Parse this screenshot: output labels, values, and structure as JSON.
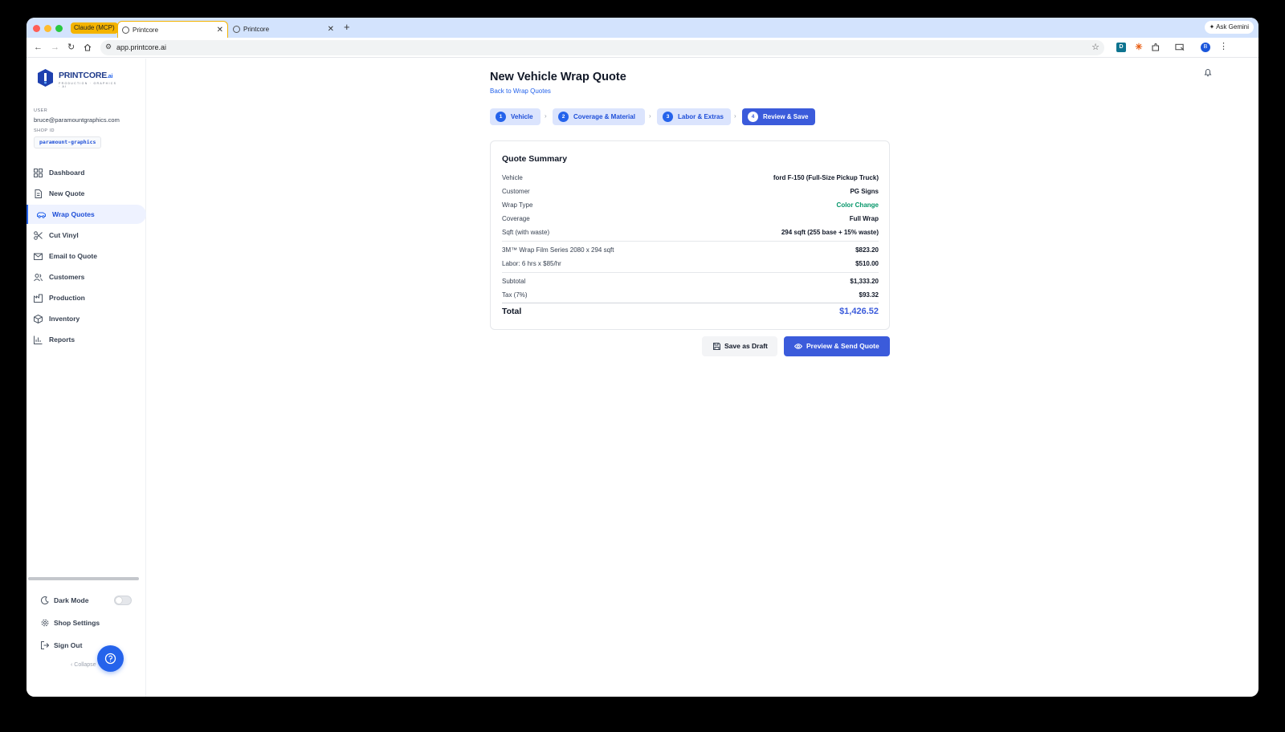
{
  "browser": {
    "tab_group_label": "Claude (MCP)",
    "tabs": [
      {
        "title": "Printcore",
        "active": true
      },
      {
        "title": "Printcore",
        "active": false
      }
    ],
    "url": "app.printcore.ai",
    "ask_gemini": "Ask Gemini",
    "profile_initial": "B"
  },
  "sidebar": {
    "logo_text": "PRINTCORE",
    "logo_ai": ".ai",
    "logo_sub": "PRODUCTION · GRAPHICS · AI",
    "user_label": "USER",
    "user_email": "bruce@paramountgraphics.com",
    "shop_label": "SHOP ID",
    "shop_id": "paramount-graphics",
    "nav": [
      {
        "label": "Dashboard",
        "icon": "grid-icon"
      },
      {
        "label": "New Quote",
        "icon": "file-icon"
      },
      {
        "label": "Wrap Quotes",
        "icon": "car-icon",
        "active": true
      },
      {
        "label": "Cut Vinyl",
        "icon": "scissors-icon"
      },
      {
        "label": "Email to Quote",
        "icon": "mail-icon"
      },
      {
        "label": "Customers",
        "icon": "users-icon"
      },
      {
        "label": "Production",
        "icon": "factory-icon"
      },
      {
        "label": "Inventory",
        "icon": "box-icon"
      },
      {
        "label": "Reports",
        "icon": "bar-chart-icon"
      }
    ],
    "dark_mode": "Dark Mode",
    "dark_mode_on": false,
    "shop_settings": "Shop Settings",
    "sign_out": "Sign Out",
    "collapse": "Collapse"
  },
  "main": {
    "title": "New Vehicle Wrap Quote",
    "back_link": "Back to Wrap Quotes",
    "steps": [
      {
        "num": "1",
        "label": "Vehicle"
      },
      {
        "num": "2",
        "label": "Coverage & Material"
      },
      {
        "num": "3",
        "label": "Labor & Extras"
      },
      {
        "num": "4",
        "label": "Review & Save",
        "current": true
      }
    ],
    "summary": {
      "title": "Quote Summary",
      "vehicle_label": "Vehicle",
      "vehicle_value": "ford F-150 (Full-Size Pickup Truck)",
      "customer_label": "Customer",
      "customer_value": "PG Signs",
      "wrap_type_label": "Wrap Type",
      "wrap_type_value": "Color Change",
      "coverage_label": "Coverage",
      "coverage_value": "Full Wrap",
      "sqft_label": "Sqft (with waste)",
      "sqft_value": "294 sqft (255 base + 15% waste)",
      "material_label": "3M™ Wrap Film Series 2080 x 294 sqft",
      "material_value": "$823.20",
      "labor_label": "Labor: 6 hrs x $85/hr",
      "labor_value": "$510.00",
      "subtotal_label": "Subtotal",
      "subtotal_value": "$1,333.20",
      "tax_label": "Tax (7%)",
      "tax_value": "$93.32",
      "total_label": "Total",
      "total_value": "$1,426.52"
    },
    "save_draft": "Save as Draft",
    "preview_send": "Preview & Send Quote"
  },
  "colors": {
    "accent": "#3b5bdb",
    "link": "#2563eb",
    "success": "#059669"
  }
}
